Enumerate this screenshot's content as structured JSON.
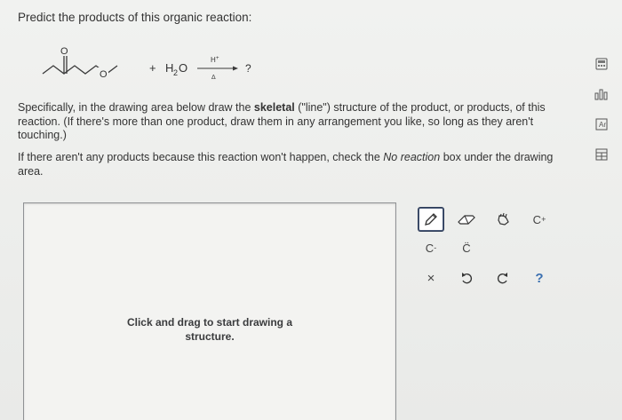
{
  "question": {
    "title": "Predict the products of this organic reaction:"
  },
  "reaction": {
    "plus": "+",
    "reagent_h": "H",
    "reagent_sub": "2",
    "reagent_o": "O",
    "catalyst": "H",
    "catalyst_sup": "+",
    "heat": "Δ",
    "product": "?",
    "carbonyl_o": "O",
    "ether_o": "O"
  },
  "instructions": {
    "part1": "Specifically, in the drawing area below draw the ",
    "bold": "skeletal",
    "part2": " (\"line\") structure of the product, or products, of this reaction. (If there's more than one product, draw them in any arrangement you like, so long as they aren't touching.)"
  },
  "note": {
    "part1": "If there aren't any products because this reaction won't happen, check the ",
    "italic": "No reaction",
    "part2": " box under the drawing area."
  },
  "drawing_area": {
    "hint_line1": "Click and drag to start drawing a",
    "hint_line2": "structure."
  },
  "toolbar": {
    "tools": [
      {
        "name": "pencil",
        "icon": "pencil-icon",
        "selected": true
      },
      {
        "name": "eraser",
        "icon": "eraser-icon"
      },
      {
        "name": "lasso",
        "icon": "lasso-icon"
      },
      {
        "name": "move",
        "icon": "hand-icon"
      },
      {
        "name": "charge-plus",
        "label": "C",
        "sup": "+"
      },
      {
        "name": "charge-minus",
        "label": "C",
        "sup": "-"
      },
      {
        "name": "lone-pair",
        "label": "C̈"
      },
      {
        "name": "clear",
        "label": "×"
      },
      {
        "name": "undo",
        "icon": "undo-icon"
      },
      {
        "name": "redo",
        "icon": "redo-icon"
      },
      {
        "name": "help",
        "label": "?"
      }
    ],
    "plus_label": "C",
    "plus_sup": "+",
    "minus_label": "C",
    "minus_sup": "-",
    "lonepair_label": "C̈",
    "clear_label": "×",
    "help_label": "?"
  },
  "side_panel": {
    "icons": [
      "calculator-icon",
      "bar-chart-icon",
      "periodic-table-icon",
      "data-table-icon"
    ]
  },
  "colors": {
    "selected_border": "#2e3d59",
    "help_blue": "#3a6fb0",
    "background": "#ecedeb"
  }
}
